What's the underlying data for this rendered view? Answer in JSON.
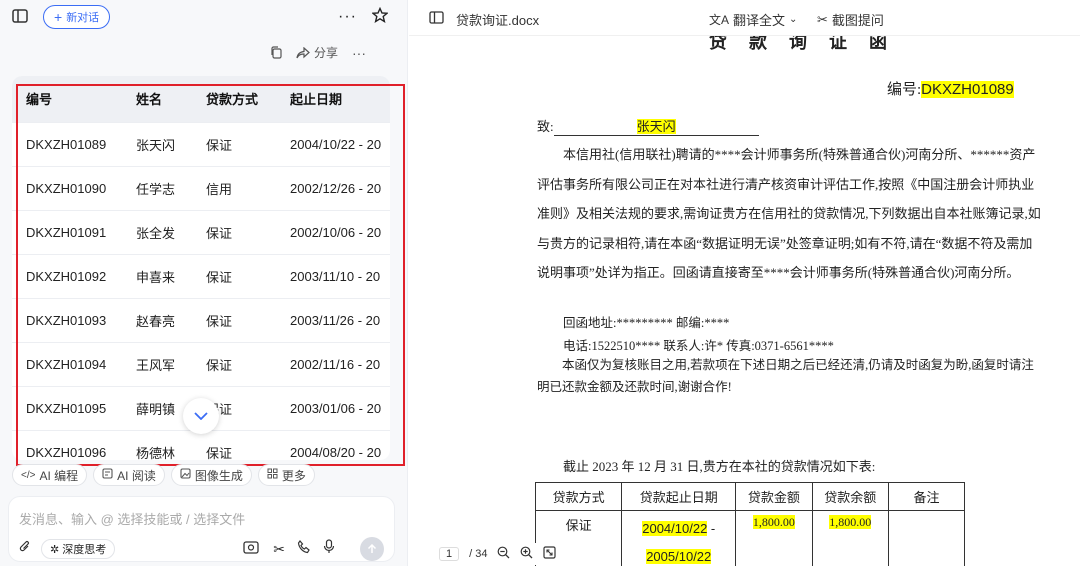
{
  "left_panel": {
    "new_chat_label": "新对话",
    "share_label": "分享",
    "table": {
      "headers": [
        "编号",
        "姓名",
        "贷款方式",
        "起止日期"
      ],
      "rows": [
        [
          "DKXZH01089",
          "张天闪",
          "保证",
          "2004/10/22 - 20"
        ],
        [
          "DKXZH01090",
          "任学志",
          "信用",
          "2002/12/26 - 20"
        ],
        [
          "DKXZH01091",
          "张全发",
          "保证",
          "2002/10/06 - 20"
        ],
        [
          "DKXZH01092",
          "申喜来",
          "保证",
          "2003/11/10 - 20"
        ],
        [
          "DKXZH01093",
          "赵春亮",
          "保证",
          "2003/11/26 - 20"
        ],
        [
          "DKXZH01094",
          "王风军",
          "保证",
          "2002/11/16 - 20"
        ],
        [
          "DKXZH01095",
          "薛明镇",
          "保证",
          "2003/01/06 - 20"
        ],
        [
          "DKXZH01096",
          "杨德林",
          "保证",
          "2004/08/20 - 20"
        ]
      ]
    },
    "chips": [
      "AI 编程",
      "AI 阅读",
      "图像生成",
      "更多"
    ],
    "input_placeholder": "发消息、输入 @ 选择技能或 / 选择文件",
    "deep_think_label": "深度思考"
  },
  "doc_panel": {
    "file_name": "贷款询证.docx",
    "translate_label": "翻译全文",
    "screenshot_label": "截图提问",
    "heading": "贷款询证函",
    "number_label": "编号:",
    "number_value": "DKXZH01089",
    "to_label": "致:",
    "to_name": "张天闪",
    "body": "本信用社(信用联社)聘请的****会计师事务所(特殊普通合伙)河南分所、******资产评估事务所有限公司正在对本社进行清产核资审计评估工作,按照《中国注册会计师执业准则》及相关法规的要求,需询证贵方在信用社的贷款情况,下列数据出自本社账簿记录,如与贵方的记录相符,请在本函“数据证明无误”处签章证明;如有不符,请在“数据不符及需加说明事项”处详为指正。回函请直接寄至****会计师事务所(特殊普通合伙)河南分所。",
    "address_line": "回函地址:********* 邮编:****",
    "phone_line": "电话:1522510****  联系人:许*  传真:0371-6561****",
    "notice": "本函仅为复核账目之用,若款项在下述日期之后已经还清,仍请及时函复为盼,函复时请注明已还款金额及还款时间,谢谢合作!",
    "cutoff": "截止 2023 年 12 月 31 日,贵方在本社的贷款情况如下表:",
    "loan_table": {
      "headers": [
        "贷款方式",
        "贷款起止日期",
        "贷款金额",
        "贷款余额",
        "备注"
      ],
      "row": {
        "method": "保证",
        "start": "2004/10/22",
        "dash": " -",
        "end": "2005/10/22",
        "amount": "1,800.00",
        "balance": "1,800.00",
        "remark": ""
      }
    },
    "page_current": "1",
    "page_total": "/ 34"
  },
  "colors": {
    "accent": "#3b6df5",
    "highlight": "#ffff00",
    "annotation": "#e0202a"
  }
}
